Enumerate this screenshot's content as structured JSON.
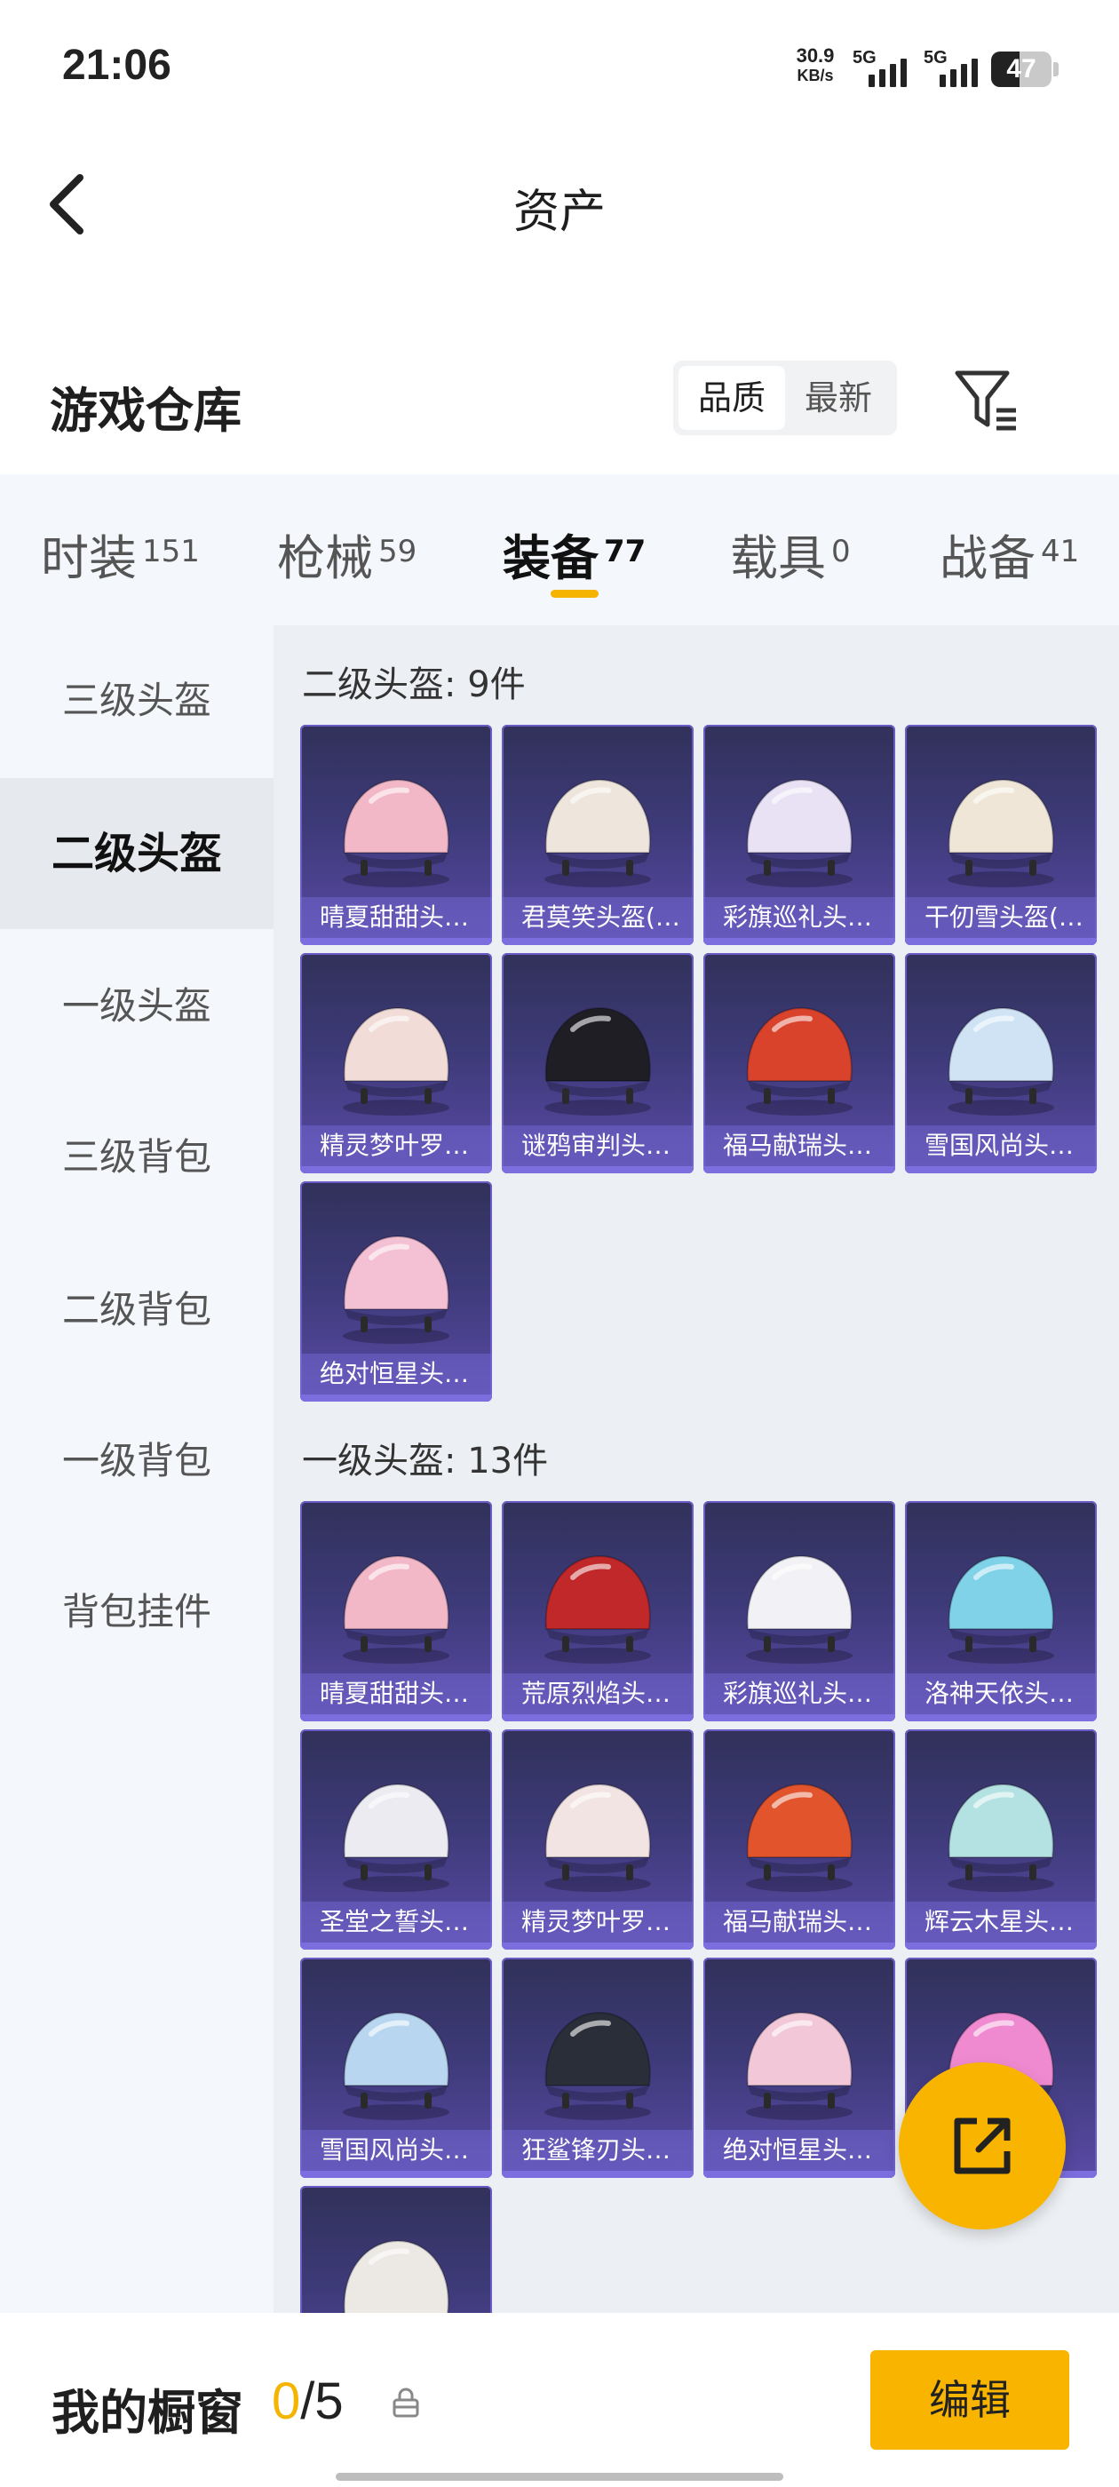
{
  "status_bar": {
    "time": "21:06",
    "net_speed_value": "30.9",
    "net_speed_unit": "KB/s",
    "sim1": "5G",
    "sim2": "5G",
    "battery": "47"
  },
  "header": {
    "title": "资产"
  },
  "warehouse": {
    "title": "游戏仓库",
    "sort_options": [
      "品质",
      "最新"
    ],
    "selected_sort": "品质"
  },
  "tabs": [
    {
      "label": "时装",
      "count": "151"
    },
    {
      "label": "枪械",
      "count": "59"
    },
    {
      "label": "装备",
      "count": "77"
    },
    {
      "label": "载具",
      "count": "0"
    },
    {
      "label": "战备",
      "count": "41"
    }
  ],
  "active_tab": "装备",
  "sidebar": [
    "三级头盔",
    "二级头盔",
    "一级头盔",
    "三级背包",
    "二级背包",
    "一级背包",
    "背包挂件"
  ],
  "active_sidebar": "二级头盔",
  "sections": [
    {
      "title": "二级头盔: 9件",
      "items": [
        {
          "name": "晴夏甜甜头…",
          "color": "#f2b8c8"
        },
        {
          "name": "君莫笑头盔(…",
          "color": "#eee6dc"
        },
        {
          "name": "彩旗巡礼头…",
          "color": "#e8e2f4"
        },
        {
          "name": "干仞雪头盔(…",
          "color": "#efe6d8"
        },
        {
          "name": "精灵梦叶罗…",
          "color": "#f1dcd8"
        },
        {
          "name": "谜鸦审判头…",
          "color": "#1e1e24"
        },
        {
          "name": "福马献瑞头…",
          "color": "#d9432c"
        },
        {
          "name": "雪国风尚头…",
          "color": "#cfe3f4"
        },
        {
          "name": "绝对恒星头…",
          "color": "#f4c0d4"
        }
      ]
    },
    {
      "title": "一级头盔: 13件",
      "items": [
        {
          "name": "晴夏甜甜头…",
          "color": "#f2b8c8"
        },
        {
          "name": "荒原烈焰头…",
          "color": "#c0282a"
        },
        {
          "name": "彩旗巡礼头…",
          "color": "#f2f2f6"
        },
        {
          "name": "洛神天依头…",
          "color": "#7fd2e8"
        },
        {
          "name": "圣堂之誓头…",
          "color": "#ecebf2"
        },
        {
          "name": "精灵梦叶罗…",
          "color": "#f2e4e2"
        },
        {
          "name": "福马献瑞头…",
          "color": "#e2542c"
        },
        {
          "name": "辉云木星头…",
          "color": "#b4e2e2"
        },
        {
          "name": "雪国风尚头…",
          "color": "#b8d6f0"
        },
        {
          "name": "狂鲨锋刃头…",
          "color": "#2a2e38"
        },
        {
          "name": "绝对恒星头…",
          "color": "#f2c8d8"
        },
        {
          "name": "",
          "color": "#f08ad0"
        },
        {
          "name": "",
          "color": "#ece8e4"
        }
      ]
    }
  ],
  "bottom": {
    "showcase_label": "我的橱窗",
    "showcase_current": "0",
    "showcase_total": "/5",
    "edit_label": "编辑"
  },
  "accent_color": "#f9b400"
}
